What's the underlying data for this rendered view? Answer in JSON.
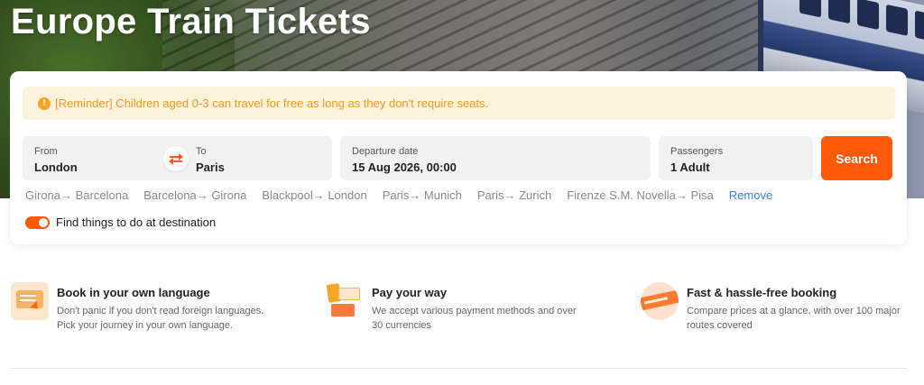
{
  "hero": {
    "title": "Europe Train Tickets"
  },
  "reminder": {
    "icon": "warning-icon",
    "text": "[Reminder] Children aged 0-3 can travel for free as long as they don't require seats."
  },
  "search": {
    "from_label": "From",
    "from_value": "London",
    "to_label": "To",
    "to_value": "Paris",
    "swap_icon": "swap-arrows-icon",
    "departure_label": "Departure date",
    "departure_value": "15 Aug 2026, 00:00",
    "passengers_label": "Passengers",
    "passengers_value": "1 Adult",
    "search_label": "Search"
  },
  "recent_routes": [
    "Girona→ Barcelona",
    "Barcelona→ Girona",
    "Blackpool→ London",
    "Paris→ Munich",
    "Paris→ Zurich",
    "Firenze S.M. Novella→ Pisa"
  ],
  "recent_remove_label": "Remove",
  "toggle": {
    "label": "Find things to do at destination",
    "on": true
  },
  "features": [
    {
      "icon": "language-card-icon",
      "title": "Book in your own language",
      "desc": "Don't panic if you don't read foreign languages. Pick your journey in your own language."
    },
    {
      "icon": "payment-cards-icon",
      "title": "Pay your way",
      "desc": "We accept various payment methods and over 30 currencies"
    },
    {
      "icon": "fast-train-icon",
      "title": "Fast & hassle-free booking",
      "desc": "Compare prices at a glance, with over 100 major routes covered"
    }
  ],
  "colors": {
    "accent": "#ff5a0a",
    "link": "#3b7bd9",
    "reminder_bg": "#fdf3dc",
    "reminder_text": "#f29a1e"
  }
}
